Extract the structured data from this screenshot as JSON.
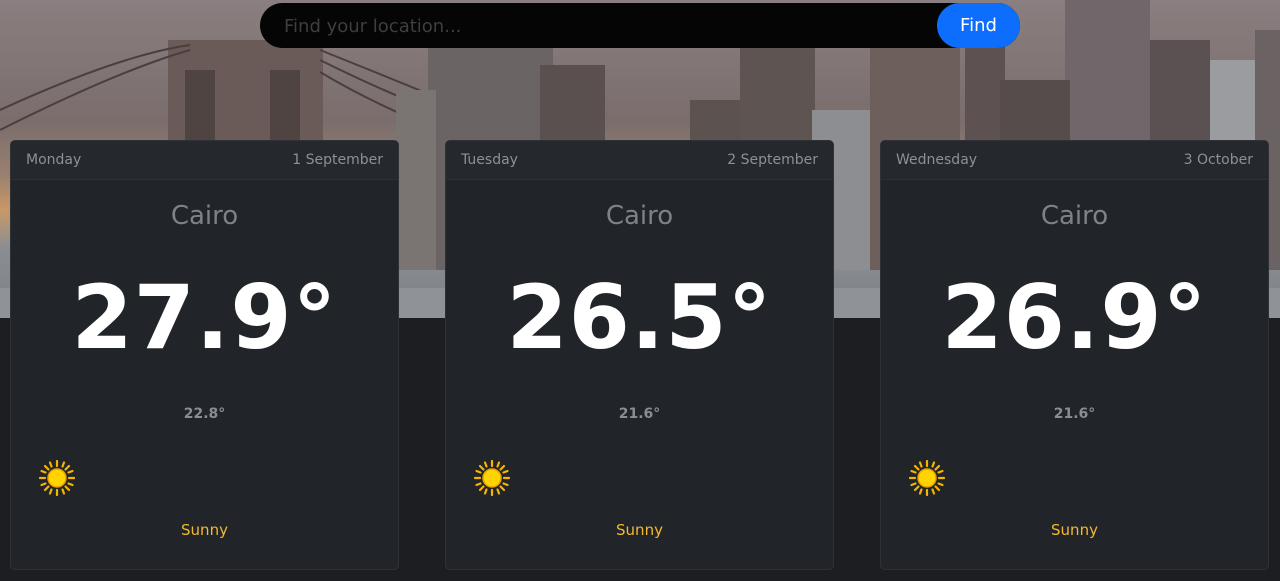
{
  "search": {
    "placeholder": "Find your location...",
    "button_label": "Find"
  },
  "forecast": [
    {
      "day": "Monday",
      "date": "1 September",
      "city": "Cairo",
      "max_temp": "27.9°",
      "min_temp": "22.8°",
      "condition": "Sunny",
      "icon": "sun-icon"
    },
    {
      "day": "Tuesday",
      "date": "2 September",
      "city": "Cairo",
      "max_temp": "26.5°",
      "min_temp": "21.6°",
      "condition": "Sunny",
      "icon": "sun-icon"
    },
    {
      "day": "Wednesday",
      "date": "3 October",
      "city": "Cairo",
      "max_temp": "26.9°",
      "min_temp": "21.6°",
      "condition": "Sunny",
      "icon": "sun-icon"
    }
  ],
  "colors": {
    "accent": "#0d6efd",
    "card_bg": "#212529",
    "condition_text": "#f5b82e",
    "sun": "#ffd400"
  }
}
